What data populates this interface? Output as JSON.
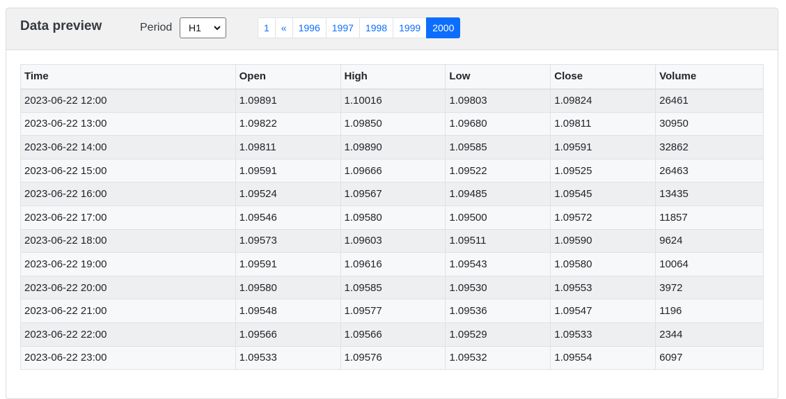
{
  "header": {
    "title": "Data preview",
    "period_label": "Period",
    "period_value": "H1"
  },
  "pagination": {
    "pages": [
      "1",
      "«",
      "1996",
      "1997",
      "1998",
      "1999",
      "2000"
    ],
    "active": "2000"
  },
  "table": {
    "columns": [
      "Time",
      "Open",
      "High",
      "Low",
      "Close",
      "Volume"
    ],
    "rows": [
      [
        "2023-06-22 12:00",
        "1.09891",
        "1.10016",
        "1.09803",
        "1.09824",
        "26461"
      ],
      [
        "2023-06-22 13:00",
        "1.09822",
        "1.09850",
        "1.09680",
        "1.09811",
        "30950"
      ],
      [
        "2023-06-22 14:00",
        "1.09811",
        "1.09890",
        "1.09585",
        "1.09591",
        "32862"
      ],
      [
        "2023-06-22 15:00",
        "1.09591",
        "1.09666",
        "1.09522",
        "1.09525",
        "26463"
      ],
      [
        "2023-06-22 16:00",
        "1.09524",
        "1.09567",
        "1.09485",
        "1.09545",
        "13435"
      ],
      [
        "2023-06-22 17:00",
        "1.09546",
        "1.09580",
        "1.09500",
        "1.09572",
        "11857"
      ],
      [
        "2023-06-22 18:00",
        "1.09573",
        "1.09603",
        "1.09511",
        "1.09590",
        "9624"
      ],
      [
        "2023-06-22 19:00",
        "1.09591",
        "1.09616",
        "1.09543",
        "1.09580",
        "10064"
      ],
      [
        "2023-06-22 20:00",
        "1.09580",
        "1.09585",
        "1.09530",
        "1.09553",
        "3972"
      ],
      [
        "2023-06-22 21:00",
        "1.09548",
        "1.09577",
        "1.09536",
        "1.09547",
        "1196"
      ],
      [
        "2023-06-22 22:00",
        "1.09566",
        "1.09566",
        "1.09529",
        "1.09533",
        "2344"
      ],
      [
        "2023-06-22 23:00",
        "1.09533",
        "1.09576",
        "1.09532",
        "1.09554",
        "6097"
      ]
    ]
  },
  "colors": {
    "accent": "#0d6efd",
    "header_bg": "#f1f1f1",
    "row_odd": "#eeeff1",
    "row_even": "#f7f8fa"
  }
}
